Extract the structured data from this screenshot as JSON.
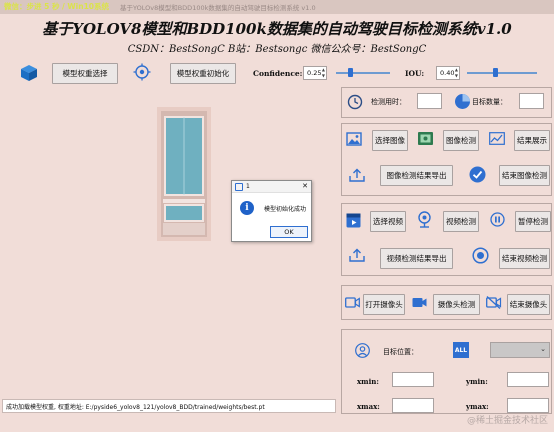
{
  "window": {
    "overlay_text": "微信：步进 5 秒 / Win10系统",
    "title": "基于YOLOv8模型和BDD100k数据集的自动驾驶目标检测系统 v1.0"
  },
  "header": {
    "title": "基于YOLOV8模型和BDD100k数据集的自动驾驶目标检测系统v1.0",
    "subtitle": "CSDN：BestSongC   B站：Bestsongc   微信公众号：BestSongC"
  },
  "toolbar": {
    "select_weights_label": "模型权重选择",
    "init_weights_label": "模型权重初始化",
    "confidence_label": "Confidence:",
    "confidence_value": "0.25",
    "confidence_level": 0.25,
    "iou_label": "IOU:",
    "iou_value": "0.40",
    "iou_level": 0.4
  },
  "detection_info": {
    "time_label": "检测用时：",
    "time_value": "",
    "count_label": "目标数量：",
    "count_value": ""
  },
  "image_section": {
    "select_label": "选择图像",
    "detect_label": "图像检测",
    "show_label": "结果展示",
    "export_label": "图像检测结果导出",
    "stop_label": "结束图像检测"
  },
  "video_section": {
    "select_label": "选择视频",
    "detect_label": "视频检测",
    "pause_label": "暂停检测",
    "export_label": "视频检测结果导出",
    "stop_label": "结束视频检测"
  },
  "camera_section": {
    "open_label": "打开摄像头",
    "detect_label": "摄像头检测",
    "stop_label": "结束摄像头"
  },
  "position_section": {
    "target_label": "目标位置：",
    "all_badge": "ALL",
    "select_value": "",
    "xmin_label": "xmin:",
    "ymin_label": "ymin:",
    "xmax_label": "xmax:",
    "ymax_label": "ymax:",
    "xmin_value": "",
    "ymin_value": "",
    "xmax_value": "",
    "ymax_value": ""
  },
  "status": {
    "text": "成功加载模型权重, 权重地址: E:/pyside6_yolov8_121/yolov8_BDD/trained/weights/best.pt"
  },
  "dialog": {
    "title": "1",
    "message": "模型初始化成功",
    "ok_label": "OK"
  },
  "watermark": "@稀土掘金技术社区",
  "colors": {
    "background": "#f1ddd8",
    "accent_blue": "#2f6fd0"
  }
}
